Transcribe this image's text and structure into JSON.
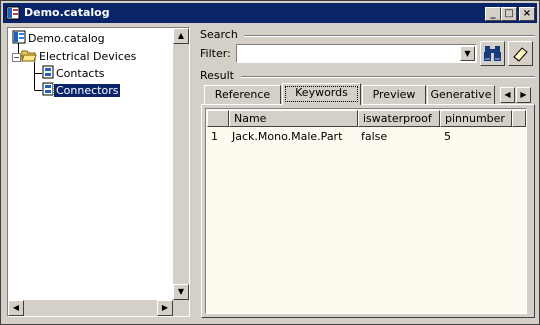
{
  "window": {
    "title": "Demo.catalog",
    "minimize": "_",
    "maximize": "□",
    "close": "×"
  },
  "tree": {
    "root": "Demo.catalog",
    "children": [
      {
        "label": "Electrical Devices",
        "children": [
          {
            "label": "Contacts"
          },
          {
            "label": "Connectors",
            "selected": true
          }
        ]
      }
    ]
  },
  "search": {
    "section_label": "Search",
    "filter_label": "Filter:",
    "filter_value": ""
  },
  "result": {
    "section_label": "Result",
    "tabs": [
      {
        "label": "Reference",
        "active": false
      },
      {
        "label": "Keywords",
        "active": true
      },
      {
        "label": "Preview",
        "active": false
      },
      {
        "label": "Generative",
        "active": false
      }
    ],
    "table": {
      "columns": [
        "",
        "Name",
        "iswaterproof",
        "pinnumber"
      ],
      "rows": [
        [
          "1",
          "Jack.Mono.Male.Part",
          "false",
          "5"
        ]
      ]
    }
  },
  "colors": {
    "titlebar": "#0a246a",
    "face": "#d4d0c8",
    "grid_bg": "#fdfbef"
  }
}
